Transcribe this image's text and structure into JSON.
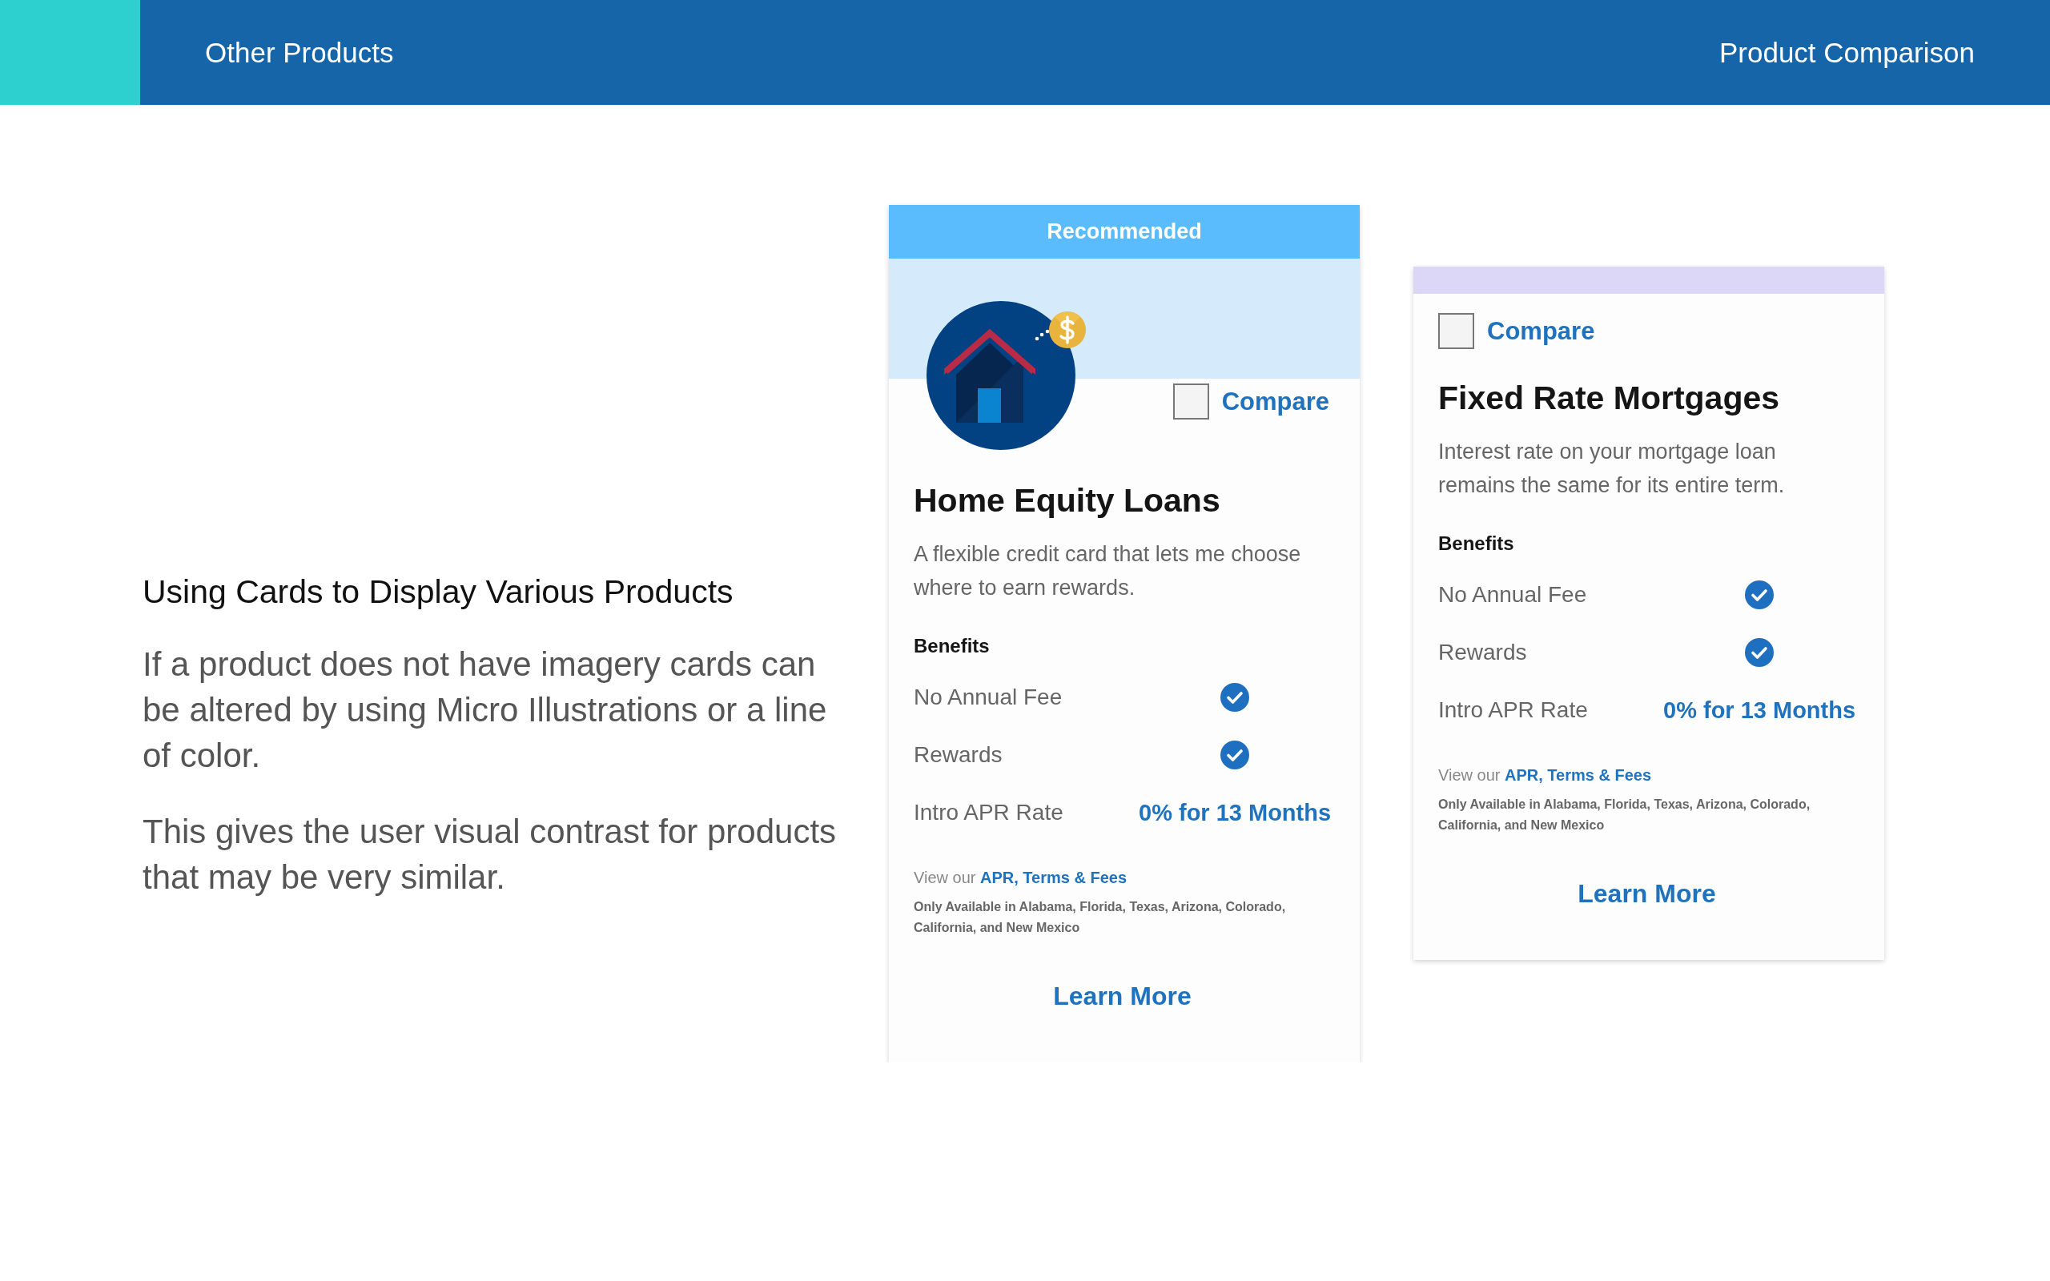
{
  "header": {
    "nav_link": "Other Products",
    "title": "Product Comparison"
  },
  "intro": {
    "heading": "Using Cards to Display Various Products",
    "paragraphs": [
      "If a product does not have imagery cards can be altered by using Micro Illustrations or a line of color.",
      "This gives the user visual contrast for products that may be very similar."
    ]
  },
  "cards": [
    {
      "kind": "illustrated",
      "badge": "Recommended",
      "compare": {
        "label": "Compare",
        "checked": false
      },
      "title": "Home Equity Loans",
      "description": "A flexible credit card that lets me choose where to earn rewards.",
      "benefits_heading": "Benefits",
      "benefits": [
        {
          "kind": "check",
          "label": "No Annual Fee",
          "checked": true
        },
        {
          "kind": "check",
          "label": "Rewards",
          "checked": true
        },
        {
          "kind": "value",
          "label": "Intro APR Rate",
          "value": "0% for 13 Months"
        }
      ],
      "terms_prefix": "View our",
      "terms_link": "APR, Terms & Fees",
      "availability": "Only Available in Alabama, Florida, Texas, Arizona, Colorado, California, and New Mexico",
      "action": "Learn More"
    },
    {
      "kind": "banded",
      "compare": {
        "label": "Compare",
        "checked": false
      },
      "title": "Fixed Rate Mortgages",
      "description": "Interest rate on your mortgage loan remains the same for its entire term.",
      "benefits_heading": "Benefits",
      "benefits": [
        {
          "kind": "check",
          "label": "No Annual Fee",
          "checked": true
        },
        {
          "kind": "check",
          "label": "Rewards",
          "checked": true
        },
        {
          "kind": "value",
          "label": "Intro APR Rate",
          "value": "0% for 13 Months"
        }
      ],
      "terms_prefix": "View our",
      "terms_link": "APR, Terms & Fees",
      "availability": "Only Available in Alabama, Florida, Texas, Arizona, Colorado, California, and New Mexico",
      "action": "Learn More"
    }
  ]
}
